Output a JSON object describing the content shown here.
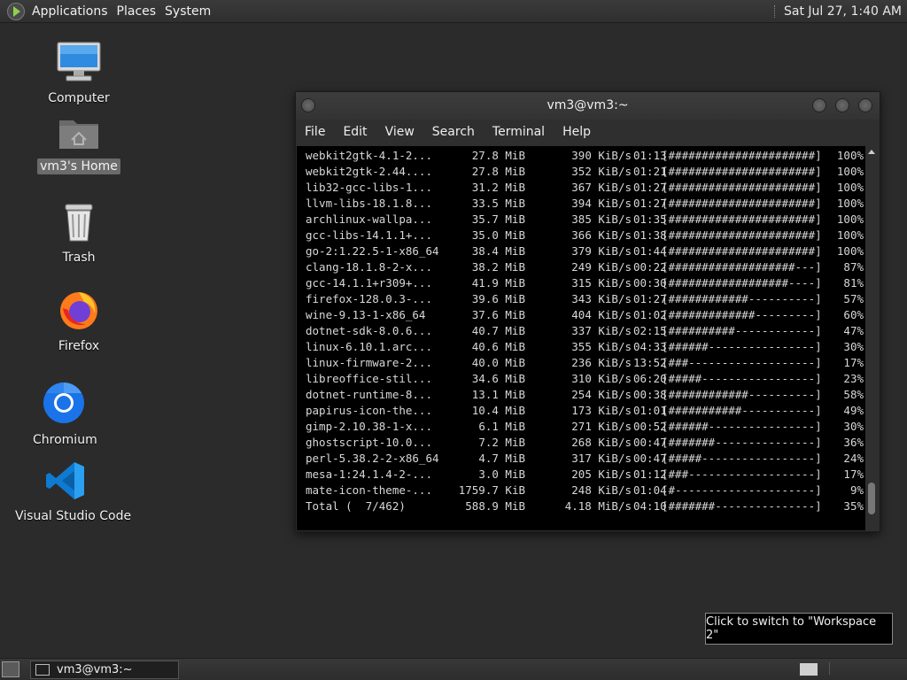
{
  "top_panel": {
    "menus": [
      "Applications",
      "Places",
      "System"
    ],
    "clock": "Sat Jul 27,  1:40 AM"
  },
  "desktop": {
    "icons": [
      {
        "label": "Computer",
        "icon": "computer-icon"
      },
      {
        "label": "vm3's Home",
        "icon": "home-folder-icon"
      },
      {
        "label": "Trash",
        "icon": "trash-icon"
      },
      {
        "label": "Firefox",
        "icon": "firefox-icon"
      },
      {
        "label": "Chromium",
        "icon": "chromium-icon"
      },
      {
        "label": "Visual Studio Code",
        "icon": "vscode-icon"
      }
    ]
  },
  "terminal": {
    "title": "vm3@vm3:~",
    "menu": [
      "File",
      "Edit",
      "View",
      "Search",
      "Terminal",
      "Help"
    ],
    "rows": [
      [
        "webkit2gtk-4.1-2...",
        "27.8 MiB",
        "390 KiB/s",
        "01:13",
        "[######################]",
        "100%"
      ],
      [
        "webkit2gtk-2.44....",
        "27.8 MiB",
        "352 KiB/s",
        "01:21",
        "[######################]",
        "100%"
      ],
      [
        "lib32-gcc-libs-1...",
        "31.2 MiB",
        "367 KiB/s",
        "01:27",
        "[######################]",
        "100%"
      ],
      [
        "llvm-libs-18.1.8...",
        "33.5 MiB",
        "394 KiB/s",
        "01:27",
        "[######################]",
        "100%"
      ],
      [
        "archlinux-wallpa...",
        "35.7 MiB",
        "385 KiB/s",
        "01:35",
        "[######################]",
        "100%"
      ],
      [
        "gcc-libs-14.1.1+...",
        "35.0 MiB",
        "366 KiB/s",
        "01:38",
        "[######################]",
        "100%"
      ],
      [
        "go-2:1.22.5-1-x86_64",
        "38.4 MiB",
        "379 KiB/s",
        "01:44",
        "[######################]",
        "100%"
      ],
      [
        "clang-18.1.8-2-x...",
        "38.2 MiB",
        "249 KiB/s",
        "00:22",
        "[###################---]",
        "87%"
      ],
      [
        "gcc-14.1.1+r309+...",
        "41.9 MiB",
        "315 KiB/s",
        "00:30",
        "[##################----]",
        "81%"
      ],
      [
        "firefox-128.0.3-...",
        "39.6 MiB",
        "343 KiB/s",
        "01:27",
        "[############----------]",
        "57%"
      ],
      [
        "wine-9.13-1-x86_64",
        "37.6 MiB",
        "404 KiB/s",
        "01:02",
        "[#############---------]",
        "60%"
      ],
      [
        "dotnet-sdk-8.0.6...",
        "40.7 MiB",
        "337 KiB/s",
        "02:15",
        "[##########------------]",
        "47%"
      ],
      [
        "linux-6.10.1.arc...",
        "40.6 MiB",
        "355 KiB/s",
        "04:33",
        "[######----------------]",
        "30%"
      ],
      [
        "linux-firmware-2...",
        "40.0 MiB",
        "236 KiB/s",
        "13:52",
        "[###-------------------]",
        "17%"
      ],
      [
        "libreoffice-stil...",
        "34.6 MiB",
        "310 KiB/s",
        "06:20",
        "[#####-----------------]",
        "23%"
      ],
      [
        "dotnet-runtime-8...",
        "13.1 MiB",
        "254 KiB/s",
        "00:38",
        "[############----------]",
        "58%"
      ],
      [
        "papirus-icon-the...",
        "10.4 MiB",
        "173 KiB/s",
        "01:01",
        "[###########-----------]",
        "49%"
      ],
      [
        "gimp-2.10.38-1-x...",
        "6.1 MiB",
        "271 KiB/s",
        "00:52",
        "[######----------------]",
        "30%"
      ],
      [
        "ghostscript-10.0...",
        "7.2 MiB",
        "268 KiB/s",
        "00:47",
        "[#######---------------]",
        "36%"
      ],
      [
        "perl-5.38.2-2-x86_64",
        "4.7 MiB",
        "317 KiB/s",
        "00:47",
        "[#####-----------------]",
        "24%"
      ],
      [
        "mesa-1:24.1.4-2-...",
        "3.0 MiB",
        "205 KiB/s",
        "01:12",
        "[###-------------------]",
        "17%"
      ],
      [
        "mate-icon-theme-...",
        "1759.7 KiB",
        "248 KiB/s",
        "01:04",
        "[#---------------------]",
        "9%"
      ],
      [
        "Total (  7/462)",
        "588.9 MiB",
        "4.18 MiB/s",
        "04:10",
        "[#######---------------]",
        "35%"
      ]
    ]
  },
  "tooltip": "Click to switch to \"Workspace 2\"",
  "bottom_panel": {
    "task_label": "vm3@vm3:~"
  }
}
